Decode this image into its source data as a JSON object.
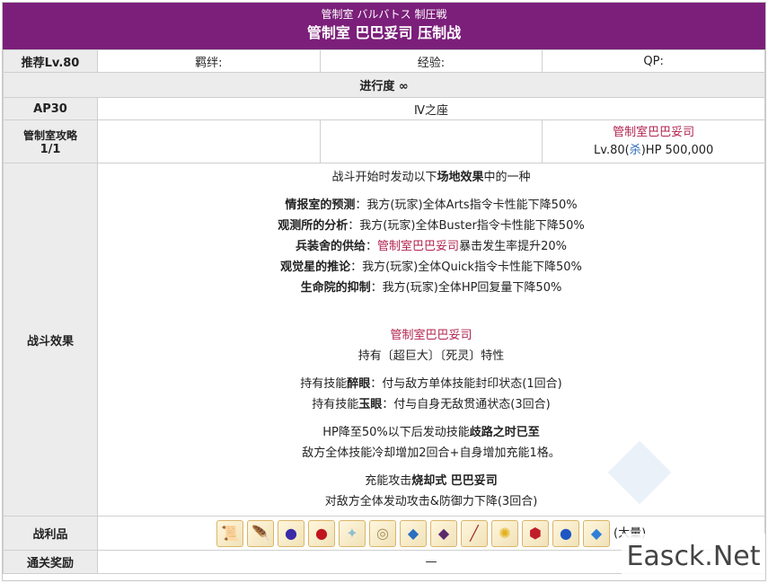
{
  "header": {
    "subtitle": "管制室 バルバトス 制圧戦",
    "title": "管制室 巴巴妥司 压制战"
  },
  "info_row": {
    "level": "推荐Lv.80",
    "bond": "羁绊:",
    "exp": "经验:",
    "qp": "QP:"
  },
  "progress": "进行度 ∞",
  "ap_row": {
    "ap": "AP30",
    "stage": "Ⅳ之座"
  },
  "battle": {
    "label_line1": "管制室攻略",
    "label_line2": "1/1",
    "enemy_name": "管制室巴巴妥司",
    "enemy_lv": "Lv.80(",
    "enemy_class": "杀",
    "enemy_hp": ")HP 500,000"
  },
  "effects": {
    "label": "战斗效果",
    "intro_a": "战斗开始时发动以下",
    "intro_b": "场地效果",
    "intro_c": "中的一种",
    "fields": [
      {
        "name": "情报室的预测",
        "desc": "：我方(玩家)全体Arts指令卡性能下降50%"
      },
      {
        "name": "观测所的分析",
        "desc": "：我方(玩家)全体Buster指令卡性能下降50%"
      },
      {
        "name": "兵装舍的供给",
        "desc_a": "：",
        "boss": "管制室巴巴妥司",
        "desc_b": "暴击发生率提升20%"
      },
      {
        "name": "观觉星的推论",
        "desc": "：我方(玩家)全体Quick指令卡性能下降50%"
      },
      {
        "name": "生命院的抑制",
        "desc": "：我方(玩家)全体HP回复量下降50%"
      }
    ],
    "boss_name": "管制室巴巴妥司",
    "traits": "持有〔超巨大〕〔死灵〕特性",
    "skill1_a": "持有技能",
    "skill1_b": "醉眼",
    "skill1_c": "：付与敌方单体技能封印状态(1回合)",
    "skill2_a": "持有技能",
    "skill2_b": "玉眼",
    "skill2_c": "：付与自身无敌贯通状态(3回合)",
    "hp_a": "HP降至50%以下后发动技能",
    "hp_b": "歧路之时已至",
    "hp_c": "敌方全体技能冷却增加2回合+自身增加充能1格。",
    "np_a": "充能攻击",
    "np_b": "烧却式 巴巴妥司",
    "np_c": "对敌方全体发动攻击&防御力下降(3回合)"
  },
  "drops": {
    "label": "战利品",
    "items": [
      {
        "icon": "book-icon",
        "glyph": "📜",
        "color": "#c8a96a"
      },
      {
        "icon": "wing-icon",
        "glyph": "🪶",
        "color": "#3e6d52"
      },
      {
        "icon": "purple-orb-icon",
        "glyph": "●",
        "color": "#3a2aa8"
      },
      {
        "icon": "red-drop-icon",
        "glyph": "●",
        "color": "#c0151f"
      },
      {
        "icon": "scroll-icon",
        "glyph": "✦",
        "color": "#8fbfd0"
      },
      {
        "icon": "nest-icon",
        "glyph": "◎",
        "color": "#a08a55"
      },
      {
        "icon": "lantern-icon",
        "glyph": "◆",
        "color": "#2a6fc0"
      },
      {
        "icon": "dark-crystal-icon",
        "glyph": "◆",
        "color": "#5a2a6a"
      },
      {
        "icon": "bone-icon",
        "glyph": "╱",
        "color": "#a02e2e"
      },
      {
        "icon": "gold-star-icon",
        "glyph": "✺",
        "color": "#e3b21f"
      },
      {
        "icon": "red-gem-icon",
        "glyph": "⬢",
        "color": "#c01d2a"
      },
      {
        "icon": "blue-gem-icon",
        "glyph": "●",
        "color": "#1f56c4"
      },
      {
        "icon": "blue-crystal-icon",
        "glyph": "◆",
        "color": "#2f7fd6"
      }
    ],
    "suffix": "(大量)"
  },
  "reward": {
    "label": "通关奖励",
    "value": "—"
  },
  "watermark": "Easck.Net"
}
